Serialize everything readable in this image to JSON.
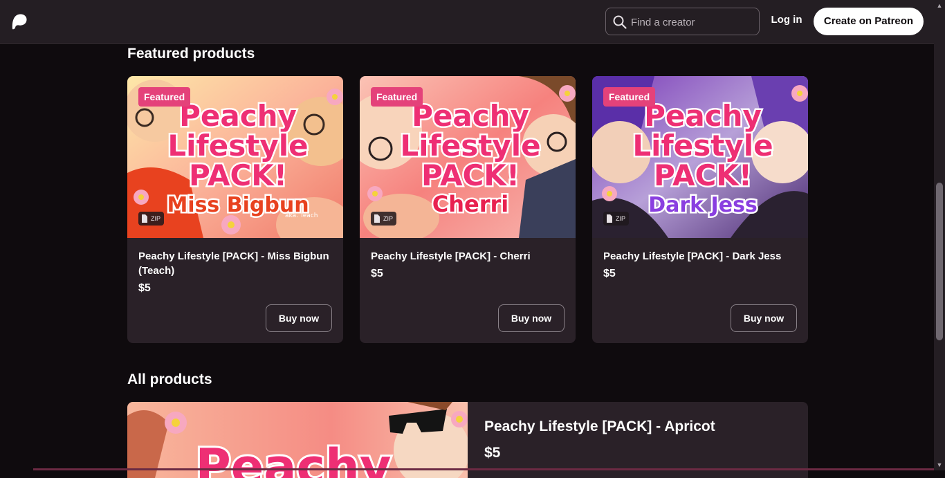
{
  "header": {
    "search_placeholder": "Find a creator",
    "login_label": "Log in",
    "create_label": "Create on Patreon"
  },
  "featured": {
    "title": "Featured products",
    "cards": [
      {
        "badge": "Featured",
        "file_type": "ZIP",
        "art_title_1": "Peachy",
        "art_title_2": "Lifestyle",
        "art_title_3": "PACK!",
        "art_subtitle": "Miss Bigbun",
        "art_note": "aka. Teach",
        "title": "Peachy Lifestyle [PACK] - Miss Bigbun (Teach)",
        "price": "$5",
        "button": "Buy now"
      },
      {
        "badge": "Featured",
        "file_type": "ZIP",
        "art_title_1": "Peachy",
        "art_title_2": "Lifestyle",
        "art_title_3": "PACK!",
        "art_subtitle": "Cherri",
        "art_note": "",
        "title": "Peachy Lifestyle [PACK] - Cherri",
        "price": "$5",
        "button": "Buy now"
      },
      {
        "badge": "Featured",
        "file_type": "ZIP",
        "art_title_1": "Peachy",
        "art_title_2": "Lifestyle",
        "art_title_3": "PACK!",
        "art_subtitle": "Dark Jess",
        "art_note": "",
        "title": "Peachy Lifestyle [PACK] - Dark Jess",
        "price": "$5",
        "button": "Buy now"
      }
    ]
  },
  "all_products": {
    "title": "All products",
    "items": [
      {
        "art_title": "Peachy",
        "title": "Peachy Lifestyle [PACK] - Apricot",
        "price": "$5"
      }
    ]
  },
  "colors": {
    "background": "#0f0b0e",
    "surface": "#2a2128",
    "topbar": "#241e23",
    "badge": "#e4427a"
  }
}
